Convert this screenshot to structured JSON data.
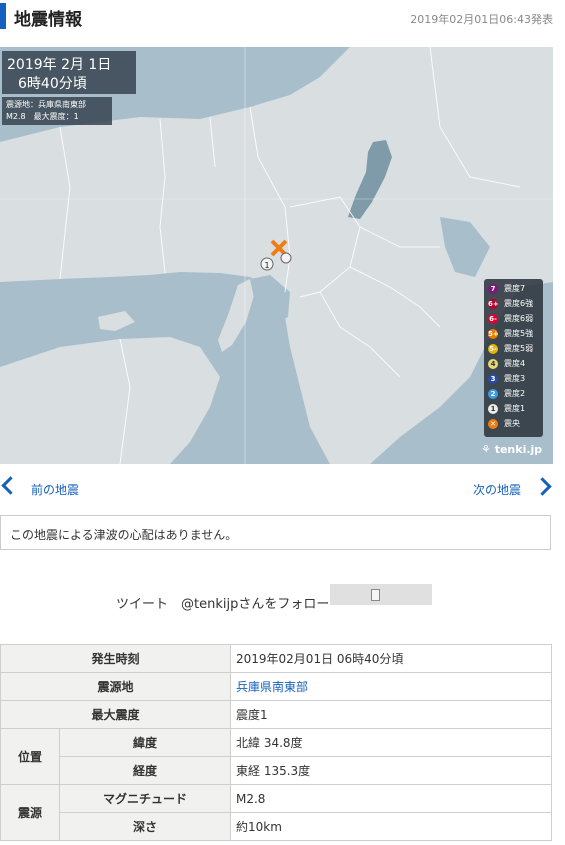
{
  "header": {
    "title": "地震情報",
    "issued": "2019年02月01日06:43発表"
  },
  "map": {
    "datetime_line1": "2019年 2月 1日",
    "datetime_line2": "6時40分頃",
    "info_line1": "震源地：兵庫県南東部",
    "info_line2": "M2.8　最大震度：1",
    "shindo_mark": "1",
    "legend": [
      {
        "num": "7",
        "label": "震度7",
        "color": "#7b1b7c"
      },
      {
        "num": "6+",
        "label": "震度6強",
        "color": "#b2002c"
      },
      {
        "num": "6-",
        "label": "震度6弱",
        "color": "#e0002d"
      },
      {
        "num": "5+",
        "label": "震度5強",
        "color": "#e97d00"
      },
      {
        "num": "5-",
        "label": "震度5弱",
        "color": "#e6b400"
      },
      {
        "num": "4",
        "label": "震度4",
        "color": "#e8d77a"
      },
      {
        "num": "3",
        "label": "震度3",
        "color": "#2b49a8"
      },
      {
        "num": "2",
        "label": "震度2",
        "color": "#3d9be0"
      },
      {
        "num": "1",
        "label": "震度1",
        "color": "#ececec"
      },
      {
        "num": "✕",
        "label": "震央",
        "color": "#ef7d14"
      }
    ],
    "brand": "tenki.jp"
  },
  "nav": {
    "prev": "前の地震",
    "next": "次の地震"
  },
  "tsunami": "この地震による津波の心配はありません。",
  "follow": "ツイート　@tenkijpさんをフォロー",
  "details": {
    "occurred_label": "発生時刻",
    "occurred_value": "2019年02月01日 06時40分頃",
    "epicenter_label": "震源地",
    "epicenter_value": "兵庫県南東部",
    "max_intensity_label": "最大震度",
    "max_intensity_value": "震度1",
    "position_label": "位置",
    "latitude_label": "緯度",
    "latitude_value": "北緯 34.8度",
    "longitude_label": "経度",
    "longitude_value": "東経 135.3度",
    "source_label": "震源",
    "magnitude_label": "マグニチュード",
    "magnitude_value": "M2.8",
    "depth_label": "深さ",
    "depth_value": "約10km"
  }
}
